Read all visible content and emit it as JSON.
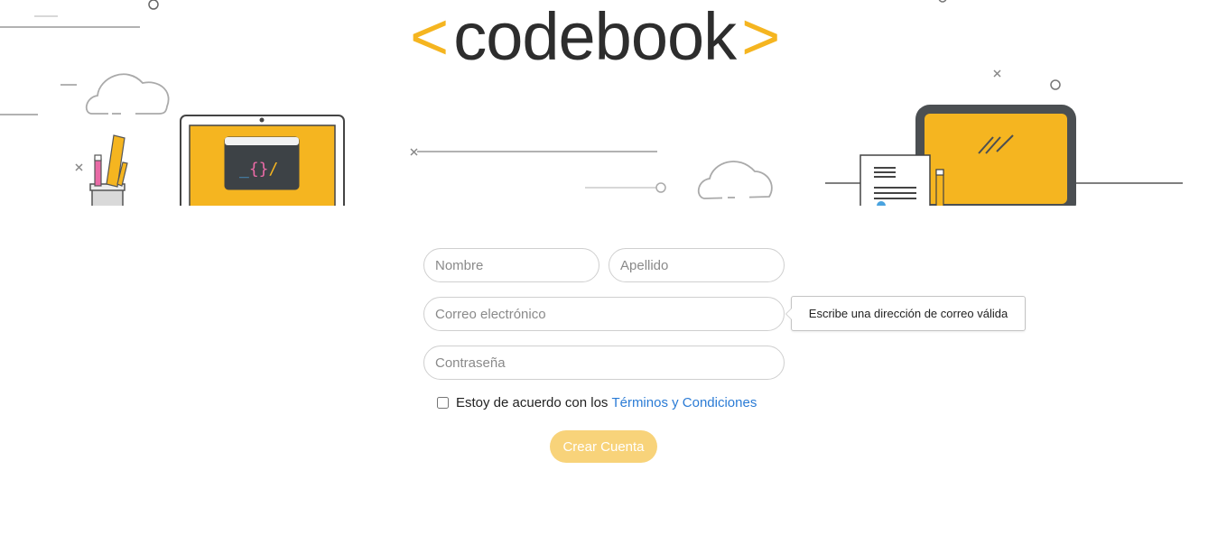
{
  "brand": {
    "left_bracket": "<",
    "name": "codebook",
    "right_bracket": ">",
    "bracket_color": "#f5b520",
    "text_color": "#2d2d2d"
  },
  "illustration": {
    "code_screen_text": "_{}/"
  },
  "form": {
    "first_name_placeholder": "Nombre",
    "last_name_placeholder": "Apellido",
    "email_placeholder": "Correo electrónico",
    "password_placeholder": "Contraseña",
    "email_validation_message": "Escribe una dirección de correo válida",
    "terms_text": "Estoy de acuerdo con los",
    "terms_link": "Términos y Condiciones",
    "terms_checked": false,
    "submit_label": "Crear Cuenta",
    "submit_color": "#f8d37a",
    "link_color": "#2a7bd5"
  }
}
